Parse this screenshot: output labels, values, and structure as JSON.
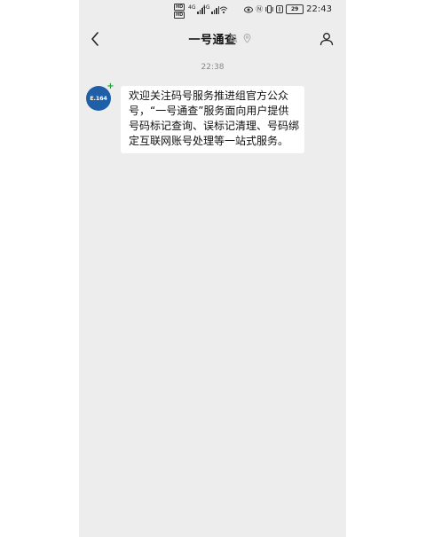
{
  "status_bar": {
    "hd1": "HD",
    "hd2": "HD",
    "sim1_tag": "4G",
    "sim2_tag": "4G",
    "battery": "29",
    "time": "22:43",
    "icons": [
      "eye-icon",
      "nfc-icon",
      "vibrate-icon",
      "ring-icon",
      "wifi-icon",
      "signal-icon",
      "battery-icon"
    ]
  },
  "nav": {
    "title": "一号通查",
    "icons": [
      "back-chevron-icon",
      "mute-bell-icon",
      "location-pin-icon",
      "profile-icon"
    ]
  },
  "chat": {
    "timestamp": "22:38",
    "avatar_label": "E.164",
    "message": "欢迎关注码号服务推进组官方公众号，“一号通查”服务面向用户提供号码标记查询、误标记清理、号码绑定互联网账号处理等一站式服务。"
  },
  "colors": {
    "background": "#ededed",
    "avatar": "#1f5fa8",
    "badge": "#22a33a",
    "bubble": "#ffffff"
  }
}
